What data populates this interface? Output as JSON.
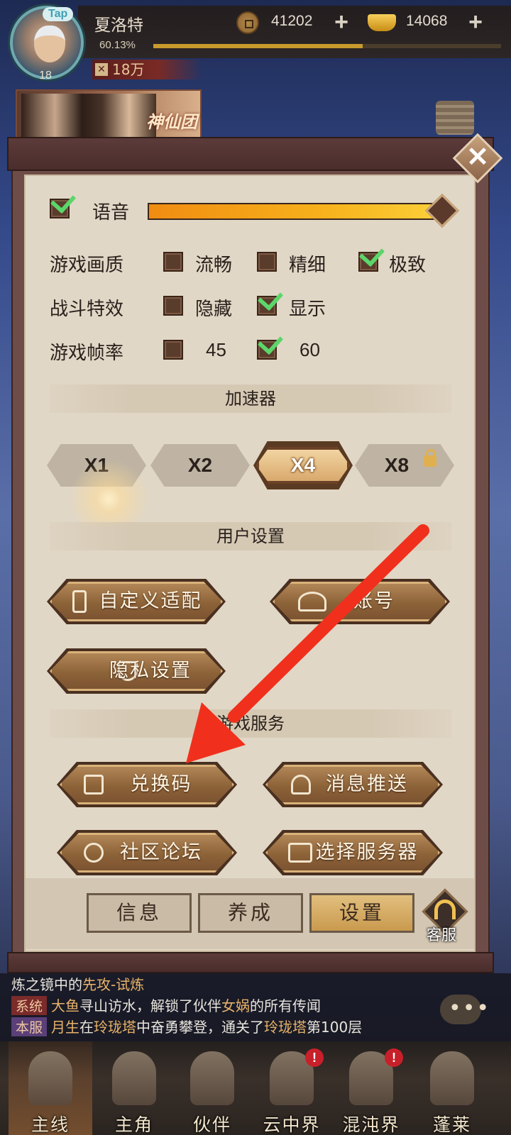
{
  "player": {
    "name": "夏洛特",
    "level": "18",
    "exp_percent": "60.13%",
    "exp_fraction": 0.6013,
    "power": "18万",
    "avatar_badge": "Tap"
  },
  "currency": {
    "coins": "41202",
    "gold": "14068",
    "coin_icon": "copper-coin-icon",
    "gold_icon": "gold-ingot-icon"
  },
  "banner": {
    "title": "神仙团"
  },
  "settings": {
    "voice": {
      "label": "语音",
      "checked": true,
      "volume": 1.0
    },
    "quality": {
      "label": "游戏画质",
      "options": [
        "流畅",
        "精细",
        "极致"
      ],
      "selected": "极致"
    },
    "effects": {
      "label": "战斗特效",
      "options": [
        "隐藏",
        "显示"
      ],
      "selected": "显示"
    },
    "framerate": {
      "label": "游戏帧率",
      "options": [
        "45",
        "60"
      ],
      "selected": "60"
    },
    "accelerator": {
      "title": "加速器",
      "options": [
        "X1",
        "X2",
        "X4",
        "X8"
      ],
      "selected": "X4",
      "locked": [
        "X8"
      ]
    },
    "user_settings": {
      "title": "用户设置",
      "buttons": [
        "自定义适配",
        "账号",
        "隐私设置"
      ]
    },
    "game_services": {
      "title": "游戏服务",
      "buttons": [
        "兑换码",
        "消息推送",
        "社区论坛",
        "选择服务器"
      ]
    }
  },
  "tabs": [
    "信息",
    "养成",
    "设置"
  ],
  "active_tab": "设置",
  "customer_service": "客服",
  "chat": {
    "line0_a": "炼之镜中的",
    "line0_b": "先攻-试炼",
    "line1_tag": "系统",
    "line1_a": "大鱼",
    "line1_b": "寻山访水，解锁了伙伴",
    "line1_c": "女娲",
    "line1_d": "的所有传闻",
    "line2_tag": "本服",
    "line2_a": "月生",
    "line2_b": "在",
    "line2_c": "玲珑塔",
    "line2_d": "中奋勇攀登，通关了",
    "line2_e": "玲珑塔",
    "line2_f": "第100层"
  },
  "nav": [
    {
      "label": "主线",
      "badge": ""
    },
    {
      "label": "主角",
      "badge": ""
    },
    {
      "label": "伙伴",
      "badge": ""
    },
    {
      "label": "云中界",
      "badge": "!"
    },
    {
      "label": "混沌界",
      "badge": "!"
    },
    {
      "label": "蓬莱",
      "badge": ""
    }
  ],
  "colors": {
    "annotation_arrow": "#f0301c",
    "check": "#5bd66a",
    "volume": "#f7b21c",
    "panel_bg": "#e1d7c6"
  }
}
